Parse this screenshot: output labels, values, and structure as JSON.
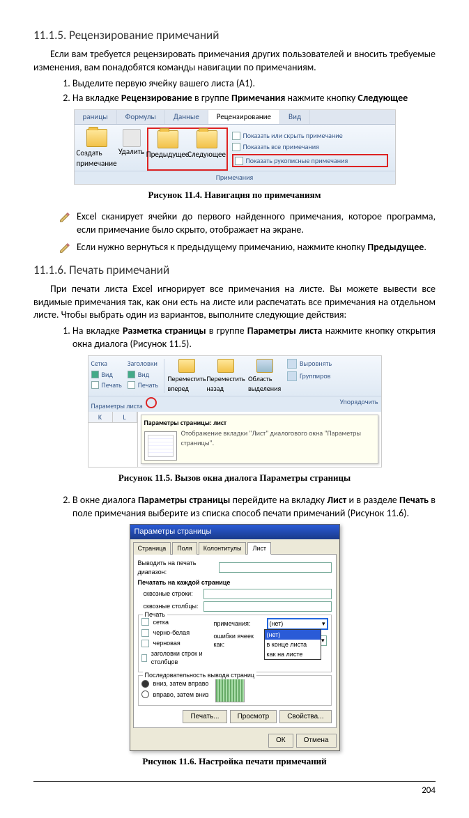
{
  "section1": {
    "heading": "11.1.5. Рецензирование примечаний",
    "intro": "Если вам требуется рецензировать примечания других пользователей и вносить требуемые изменения, вам понадобятся команды навигации по примечаниям.",
    "step1": "Выделите первую ячейку вашего листа (A1).",
    "step2_pre": "На вкладке ",
    "step2_b1": "Рецензирование",
    "step2_mid": " в группе ",
    "step2_b2": "Примечания",
    "step2_mid2": " нажмите кнопку ",
    "step2_b3": "Следующее"
  },
  "fig1": {
    "tabs": {
      "t1": "раницы",
      "t2": "Формулы",
      "t3": "Данные",
      "t4": "Рецензирование",
      "t5": "Вид"
    },
    "btn_create": "Создать примечание",
    "btn_delete": "Удалить",
    "btn_prev": "Предыдущее",
    "btn_next": "Следующее",
    "chk1": "Показать или скрыть примечание",
    "chk2": "Показать все примечания",
    "chk3": "Показать рукописные примечания",
    "group": "Примечания",
    "caption": "Рисунок 11.4. Навигация по  примечаниям"
  },
  "pencils": {
    "p1": "Excel сканирует ячейки до первого найденного примечания, которое программа, если примечание было скрыто, отображает на экране.",
    "p2_pre": "Если нужно вернуться к предыдущему примечанию, нажмите кнопку ",
    "p2_b": "Предыдущее",
    "p2_post": "."
  },
  "section2": {
    "heading": "11.1.6. Печать примечаний",
    "intro": "При печати листа Excel игнорирует все примечания на листе. Вы можете вывести все видимые примечания так, как они есть на листе или распечатать все примечания на отдельном листе. Чтобы выбрать один из вариантов, выполните следующие действия:",
    "step1_pre": "На вкладке ",
    "step1_b1": "Разметка страницы",
    "step1_mid": " в группе ",
    "step1_b2": "Параметры листа",
    "step1_post": "  нажмите кнопку открытия окна диалога (Рисунок 11.5)."
  },
  "fig2": {
    "hdr_grid": "Сетка",
    "hdr_head": "Заголовки",
    "chk_view": "Вид",
    "chk_print": "Печать",
    "btn_fwd": "Переместить вперед",
    "btn_back": "Переместить назад",
    "btn_sel": "Область выделения",
    "btn_align": "Выровнять",
    "btn_group": "Группиров",
    "bar_left": "Параметры листа",
    "bar_right": "Упорядочить",
    "col_k": "K",
    "col_l": "L",
    "tt_title": "Параметры страницы: лист",
    "tt_body": "Отображение вкладки \"Лист\" диалогового окна \"Параметры страницы\".",
    "caption": "Рисунок 11.5. Вызов окна диалога Параметры страницы"
  },
  "step2_2": {
    "pre": "В окне диалога ",
    "b1": "Параметры страницы",
    "mid1": " перейдите на вкладку ",
    "b2": "Лист",
    "mid2": " и в разделе ",
    "b3": "Печать",
    "mid3": " в поле примечания выберите из списка способ печати примечаний (Рисунок 11.6)."
  },
  "fig3": {
    "title": "Параметры страницы",
    "tabs": {
      "t1": "Страница",
      "t2": "Поля",
      "t3": "Колонтитулы",
      "t4": "Лист"
    },
    "row1": "Выводить на печать диапазон:",
    "row2": "Печатать на каждой странице",
    "row3": "сквозные строки:",
    "row4": "сквозные столбцы:",
    "grp_print": "Печать",
    "chk_grid": "сетка",
    "chk_bw": "черно-белая",
    "chk_draft": "черновая",
    "chk_rc": "заголовки строк и столбцов",
    "lbl_comments": "примечания:",
    "lbl_errors": "ошибки ячеек как:",
    "sel_none": "(нет)",
    "opt1": "(нет)",
    "opt2": "в конце листа",
    "opt3": "как на листе",
    "grp_order": "Последовательность вывода страниц",
    "rad1": "вниз, затем вправо",
    "rad2": "вправо, затем вниз",
    "btn_print": "Печать...",
    "btn_preview": "Просмотр",
    "btn_props": "Свойства...",
    "btn_ok": "ОК",
    "btn_cancel": "Отмена",
    "caption": "Рисунок 11.6. Настройка печати примечаний"
  },
  "page_number": "204"
}
